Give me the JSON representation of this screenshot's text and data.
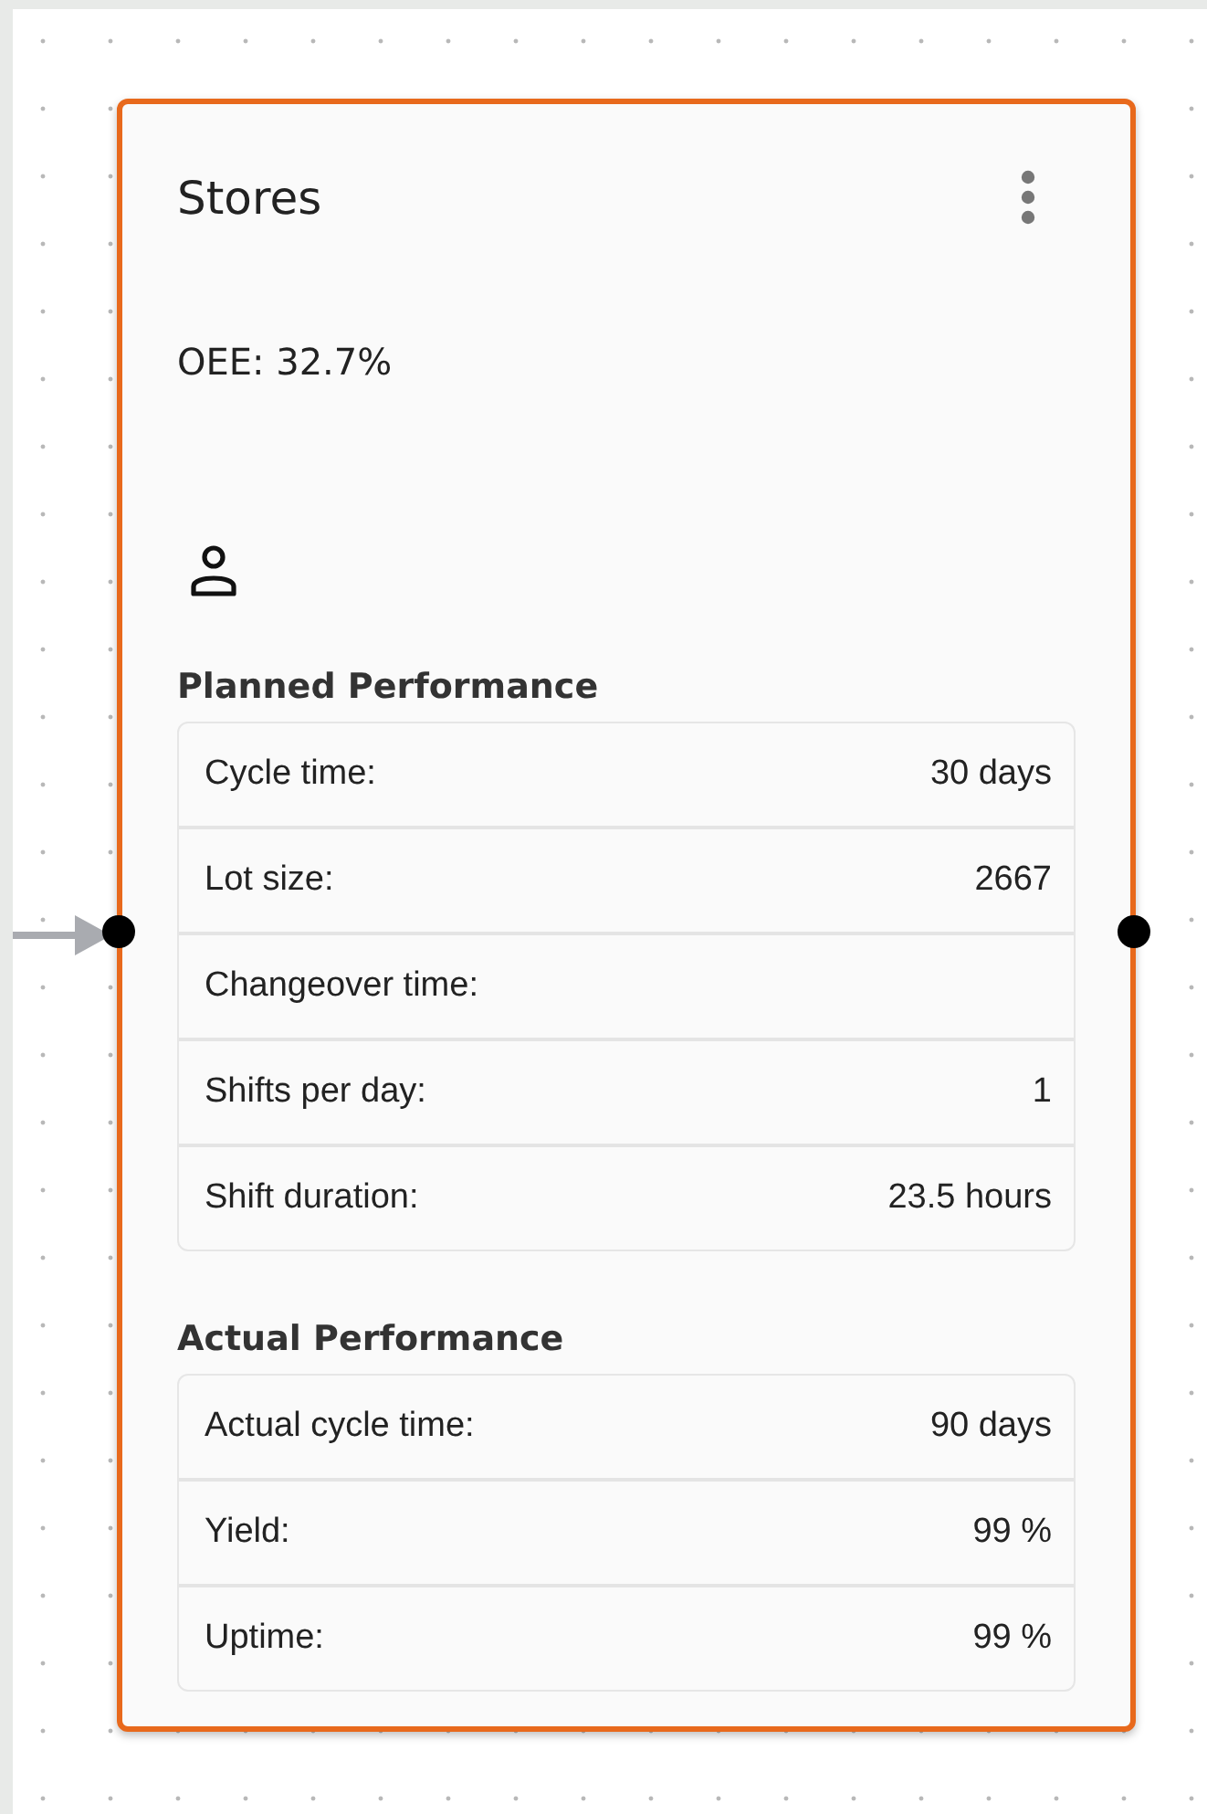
{
  "node": {
    "title": "Stores",
    "oee": "OEE: 32.7%",
    "selected": true,
    "sections": [
      {
        "heading": "Planned Performance",
        "rows": [
          {
            "label": "Cycle time:",
            "value": "30 days"
          },
          {
            "label": "Lot size:",
            "value": "2667"
          },
          {
            "label": "Changeover time:"
          },
          {
            "label": "Shifts per day:",
            "value": "1"
          },
          {
            "label": "Shift duration:",
            "value": "23.5 hours"
          }
        ]
      },
      {
        "heading": "Actual Performance",
        "rows": [
          {
            "label": "Actual cycle time:",
            "value": "90 days"
          },
          {
            "label": "Yield:",
            "value": "99 %"
          },
          {
            "label": "Uptime:",
            "value": "99 %"
          }
        ]
      }
    ]
  }
}
